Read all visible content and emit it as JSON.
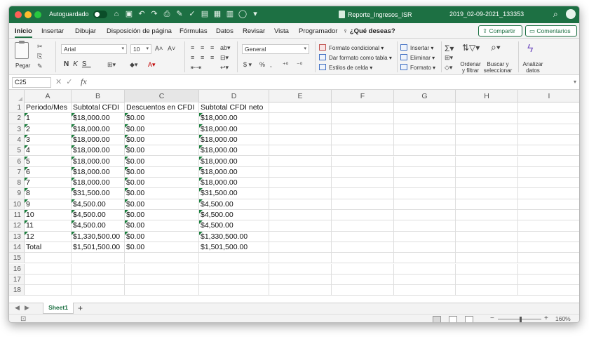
{
  "titlebar": {
    "autosave_label": "Autoguardado",
    "doc_name": "Reporte_Ingresos_ISR",
    "file_date": "2019_02-09-2021_133353"
  },
  "tabs": [
    "Inicio",
    "Insertar",
    "Dibujar",
    "Disposición de página",
    "Fórmulas",
    "Datos",
    "Revisar",
    "Vista",
    "Programador"
  ],
  "tell_me": "¿Qué deseas?",
  "share_label": "Compartir",
  "comments_label": "Comentarios",
  "ribbon": {
    "paste_label": "Pegar",
    "font_name": "Arial",
    "font_size": "10",
    "number_format": "General",
    "styles": [
      "Formato condicional",
      "Dar formato como tabla",
      "Estilos de celda"
    ],
    "cells": [
      "Insertar",
      "Eliminar",
      "Formato"
    ],
    "sort_filter_label": [
      "Ordenar",
      "y filtrar"
    ],
    "find_select_label": [
      "Buscar y",
      "seleccionar"
    ],
    "analyze_label": [
      "Analizar",
      "datos"
    ]
  },
  "formula_bar": {
    "name_box": "C25",
    "fx": "fx",
    "content": ""
  },
  "columns": [
    "A",
    "B",
    "C",
    "D",
    "E",
    "F",
    "G",
    "H",
    "I"
  ],
  "rows": [
    {
      "n": "1",
      "a": "Periodo/Mes",
      "b": "Subtotal CFDI",
      "c": "Descuentos en CFDI",
      "d": "Subtotal CFDI neto",
      "flag": false
    },
    {
      "n": "2",
      "a": "1",
      "b": "$18,000.00",
      "c": "$0.00",
      "d": "$18,000.00",
      "flag": true
    },
    {
      "n": "3",
      "a": "2",
      "b": "$18,000.00",
      "c": "$0.00",
      "d": "$18,000.00",
      "flag": true
    },
    {
      "n": "4",
      "a": "3",
      "b": "$18,000.00",
      "c": "$0.00",
      "d": "$18,000.00",
      "flag": true
    },
    {
      "n": "5",
      "a": "4",
      "b": "$18,000.00",
      "c": "$0.00",
      "d": "$18,000.00",
      "flag": true
    },
    {
      "n": "6",
      "a": "5",
      "b": "$18,000.00",
      "c": "$0.00",
      "d": "$18,000.00",
      "flag": true
    },
    {
      "n": "7",
      "a": "6",
      "b": "$18,000.00",
      "c": "$0.00",
      "d": "$18,000.00",
      "flag": true
    },
    {
      "n": "8",
      "a": "7",
      "b": "$18,000.00",
      "c": "$0.00",
      "d": "$18,000.00",
      "flag": true
    },
    {
      "n": "9",
      "a": "8",
      "b": "$31,500.00",
      "c": "$0.00",
      "d": "$31,500.00",
      "flag": true
    },
    {
      "n": "10",
      "a": "9",
      "b": "$4,500.00",
      "c": "$0.00",
      "d": "$4,500.00",
      "flag": true
    },
    {
      "n": "11",
      "a": "10",
      "b": "$4,500.00",
      "c": "$0.00",
      "d": "$4,500.00",
      "flag": true
    },
    {
      "n": "12",
      "a": "11",
      "b": "$4,500.00",
      "c": "$0.00",
      "d": "$4,500.00",
      "flag": true
    },
    {
      "n": "13",
      "a": "12",
      "b": "$1,330,500.00",
      "c": "$0.00",
      "d": "$1,330,500.00",
      "flag": true
    },
    {
      "n": "14",
      "a": "Total",
      "b": "$1,501,500.00",
      "c": "$0.00",
      "d": "$1,501,500.00",
      "flag": false
    },
    {
      "n": "15",
      "a": "",
      "b": "",
      "c": "",
      "d": "",
      "flag": false
    },
    {
      "n": "16",
      "a": "",
      "b": "",
      "c": "",
      "d": "",
      "flag": false
    },
    {
      "n": "17",
      "a": "",
      "b": "",
      "c": "",
      "d": "",
      "flag": false
    },
    {
      "n": "18",
      "a": "",
      "b": "",
      "c": "",
      "d": "",
      "flag": false
    }
  ],
  "sheets": [
    "Sheet1"
  ],
  "statusbar": {
    "zoom": "160%"
  },
  "colors": {
    "titlebar": "#1d7043",
    "accent": "#1d7043",
    "error_triangle": "#1a7f3c"
  }
}
